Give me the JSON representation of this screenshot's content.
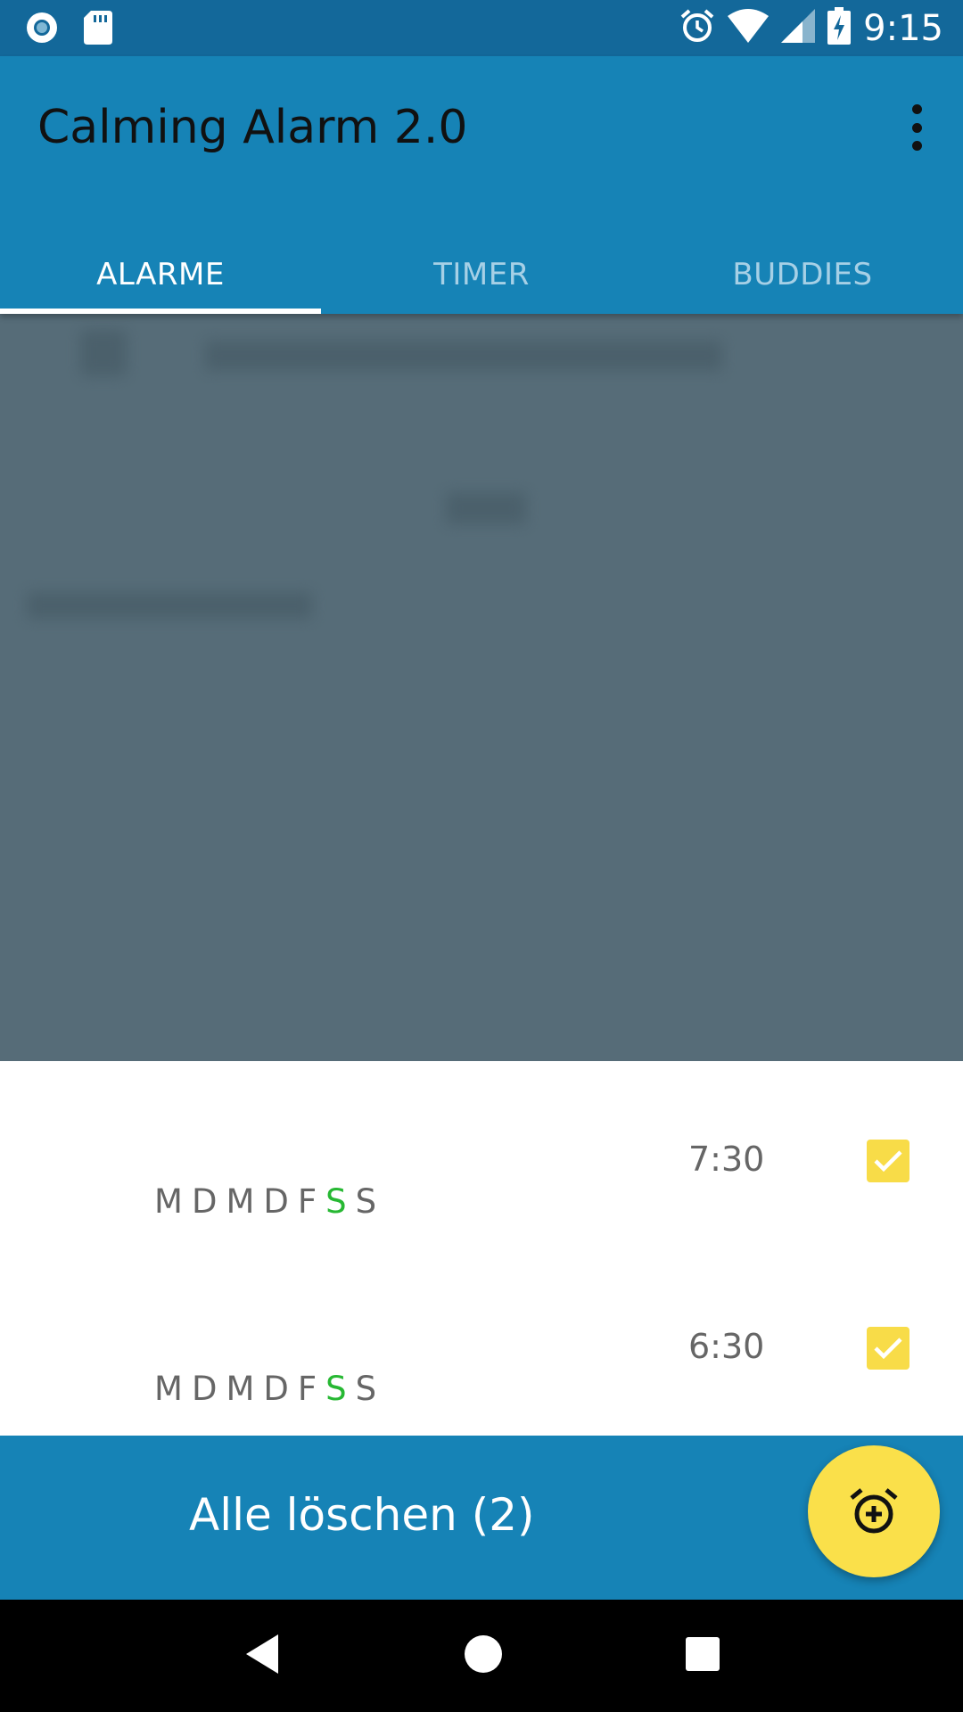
{
  "status_bar": {
    "time": "9:15",
    "icons": [
      "radio-icon",
      "sd-card-icon",
      "alarm-clock-icon",
      "wifi-icon",
      "signal-icon",
      "battery-charging-icon"
    ]
  },
  "app_bar": {
    "title": "Calming Alarm 2.0",
    "menu_icon": "more-vert-icon"
  },
  "tabs": [
    {
      "label": "ALARME",
      "active": true
    },
    {
      "label": "TIMER",
      "active": false
    },
    {
      "label": "BUDDIES",
      "active": false
    }
  ],
  "alarms": [
    {
      "time": "7:30",
      "enabled": true,
      "days": [
        "M",
        "D",
        "M",
        "D",
        "F",
        "S",
        "S"
      ],
      "highlighted_day_index": 5
    },
    {
      "time": "6:30",
      "enabled": true,
      "days": [
        "M",
        "D",
        "M",
        "D",
        "F",
        "S",
        "S"
      ],
      "highlighted_day_index": 5
    }
  ],
  "action_bar": {
    "delete_all_label": "Alle löschen (2)"
  },
  "fab": {
    "icon": "add-alarm-icon"
  },
  "nav_bar": {
    "icons": [
      "back-icon",
      "home-icon",
      "recents-icon"
    ]
  },
  "colors": {
    "status_bar": "#13689a",
    "primary": "#1683b6",
    "accent": "#fae04a",
    "highlight_day": "#27b833",
    "dim_overlay": "#566c78"
  }
}
